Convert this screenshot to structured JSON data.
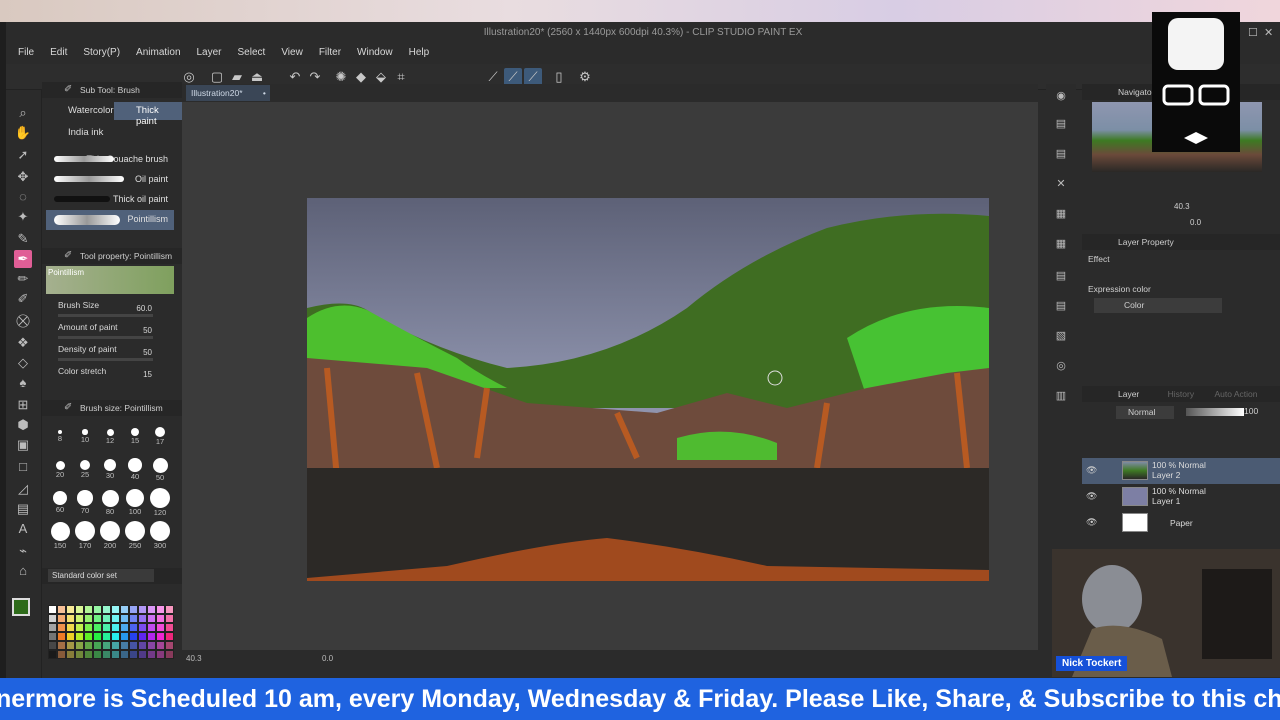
{
  "app": {
    "title": "Illustration20* (2560 x 1440px 600dpi 40.3%)  - CLIP STUDIO PAINT EX",
    "menu": [
      "File",
      "Edit",
      "Story(P)",
      "Animation",
      "Layer",
      "Select",
      "View",
      "Filter",
      "Window",
      "Help"
    ]
  },
  "subtool": {
    "header": "Sub Tool: Brush",
    "tabs": [
      "Watercolor",
      "Thick paint",
      "India ink"
    ],
    "brushes": [
      "Thin Gouache brush",
      "Oil paint",
      "Thick oil paint",
      "Pointillism"
    ]
  },
  "toolprop": {
    "header": "Tool property: Pointillism",
    "preset": "Pointillism",
    "props": [
      {
        "label": "Brush Size",
        "value": "60.0"
      },
      {
        "label": "Amount of paint",
        "value": "50"
      },
      {
        "label": "Density of paint",
        "value": "50"
      },
      {
        "label": "Color stretch",
        "value": "15"
      }
    ]
  },
  "brushsize": {
    "header": "Brush size: Pointillism",
    "sizes": [
      "8",
      "10",
      "12",
      "15",
      "17",
      "20",
      "25",
      "30",
      "40",
      "50",
      "60",
      "70",
      "80",
      "100",
      "120",
      "150",
      "170",
      "200",
      "250",
      "300"
    ]
  },
  "colorset": {
    "name": "Standard color set"
  },
  "document": {
    "tab": "Illustration20*"
  },
  "status": {
    "zoom": "40.3",
    "angle": "0.0"
  },
  "navigator": {
    "header": "Navigator",
    "zoom": "40.3",
    "angle": "0.0"
  },
  "layerprop": {
    "header": "Layer Property",
    "effect": "Effect",
    "expression_label": "Expression color",
    "expression_value": "Color"
  },
  "layers": {
    "tabs": [
      "Layer",
      "History",
      "Auto Action"
    ],
    "blend": "Normal",
    "opacity": "100",
    "items": [
      {
        "mode": "100 % Normal",
        "name": "Layer 2"
      },
      {
        "mode": "100 % Normal",
        "name": "Layer 1"
      },
      {
        "mode": "",
        "name": "Paper"
      }
    ]
  },
  "stream": {
    "name": "Nick Tockert",
    "ticker": "nermore is Scheduled 10 am, every Monday, Wednesday & Friday. Please Like, Share, & Subscribe to this chan"
  },
  "colors": {
    "accent": "#1f63e0",
    "selection": "#4b5b73",
    "main_color": "#2e6b1a"
  }
}
